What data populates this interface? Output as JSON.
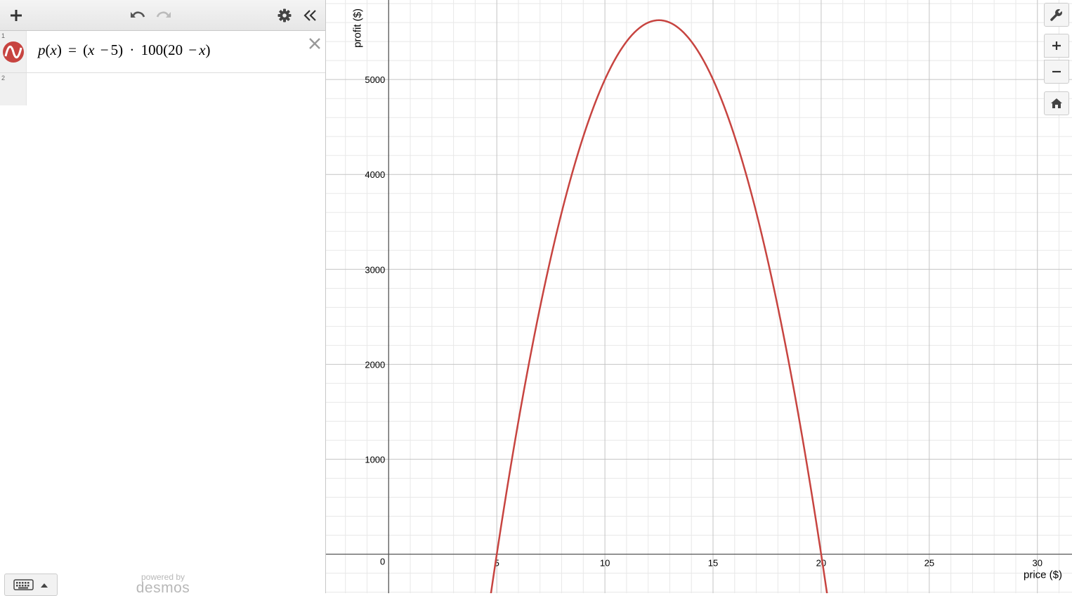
{
  "toolbar": {
    "add_icon": "plus-icon",
    "undo_icon": "undo-icon",
    "redo_icon": "redo-icon",
    "settings_icon": "gear-icon",
    "collapse_icon": "double-chevron-left-icon"
  },
  "expressions": [
    {
      "row_number": "1",
      "color": "#c74440",
      "latex_display": {
        "fn": "p",
        "var": "x",
        "eq": "=",
        "minus": "−",
        "five": "5",
        "dot": "·",
        "hundred": "100",
        "twenty": "20"
      }
    },
    {
      "row_number": "2"
    }
  ],
  "footer": {
    "powered_by": "powered by",
    "brand": "desmos"
  },
  "graph": {
    "curve_color": "#c74440",
    "x_axis_title": "price ($)",
    "y_axis_title": "profit ($)",
    "origin_label": "0",
    "x_ticks": [
      {
        "value": 5,
        "label": "5"
      },
      {
        "value": 10,
        "label": "10"
      },
      {
        "value": 15,
        "label": "15"
      },
      {
        "value": 20,
        "label": "20"
      },
      {
        "value": 25,
        "label": "25"
      },
      {
        "value": 30,
        "label": "30"
      }
    ],
    "y_ticks": [
      {
        "value": 1000,
        "label": "1000"
      },
      {
        "value": 2000,
        "label": "2000"
      },
      {
        "value": 3000,
        "label": "3000"
      },
      {
        "value": 4000,
        "label": "4000"
      },
      {
        "value": 5000,
        "label": "5000"
      }
    ]
  },
  "chart_data": {
    "type": "line",
    "function": "p(x) = (x-5)·100(20-x)",
    "xlabel": "price ($)",
    "ylabel": "profit ($)",
    "xlim": [
      -2.9,
      31.6
    ],
    "ylim": [
      -411,
      5838
    ],
    "grid": true,
    "series": [
      {
        "x": [
          4.75,
          5,
          7.5,
          10,
          12.5,
          15,
          17.5,
          20,
          20.25
        ],
        "y": [
          -381,
          0,
          3125,
          5000,
          5625,
          5000,
          3125,
          0,
          -381
        ]
      }
    ]
  },
  "graph_controls": {
    "wrench_icon": "wrench-icon",
    "zoom_in_icon": "plus-icon",
    "zoom_out_icon": "minus-icon",
    "home_icon": "home-icon"
  }
}
